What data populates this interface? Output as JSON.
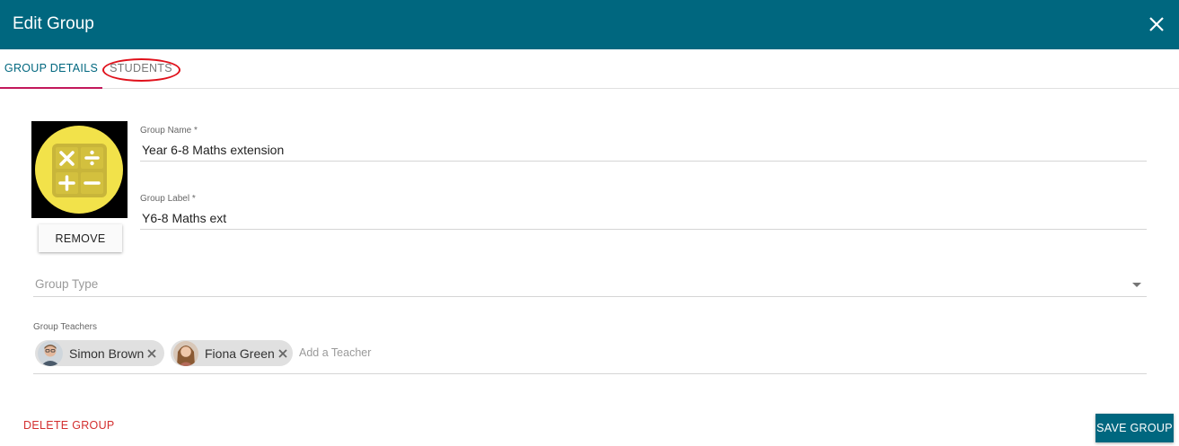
{
  "dialog": {
    "title": "Edit Group",
    "close_icon": "close-icon"
  },
  "tabs": [
    {
      "label": "GROUP DETAILS",
      "active": true
    },
    {
      "label": "STUDENTS",
      "active": false,
      "highlighted": true
    }
  ],
  "group_image": {
    "icon": "calculator-icon",
    "colors": {
      "background": "#000000",
      "circle": "#f2e24a",
      "tiles": "#c8b53a"
    },
    "remove_label": "REMOVE"
  },
  "form": {
    "group_name": {
      "label": "Group Name *",
      "value": "Year 6-8 Maths extension"
    },
    "group_label": {
      "label": "Group Label *",
      "value": "Y6-8 Maths ext"
    },
    "group_type": {
      "placeholder": "Group Type",
      "value": ""
    },
    "group_teachers": {
      "label": "Group Teachers",
      "teachers": [
        {
          "name": "Simon Brown",
          "avatar": "avatar-photo"
        },
        {
          "name": "Fiona Green",
          "avatar": "avatar-photo"
        }
      ],
      "add_placeholder": "Add a Teacher"
    }
  },
  "actions": {
    "delete_label": "DELETE GROUP",
    "save_label": "SAVE GROUP"
  },
  "colors": {
    "primary": "#00677f",
    "tab_indicator": "#c2185b",
    "danger": "#d32f2f",
    "annotation_ring": "#e0111b"
  }
}
